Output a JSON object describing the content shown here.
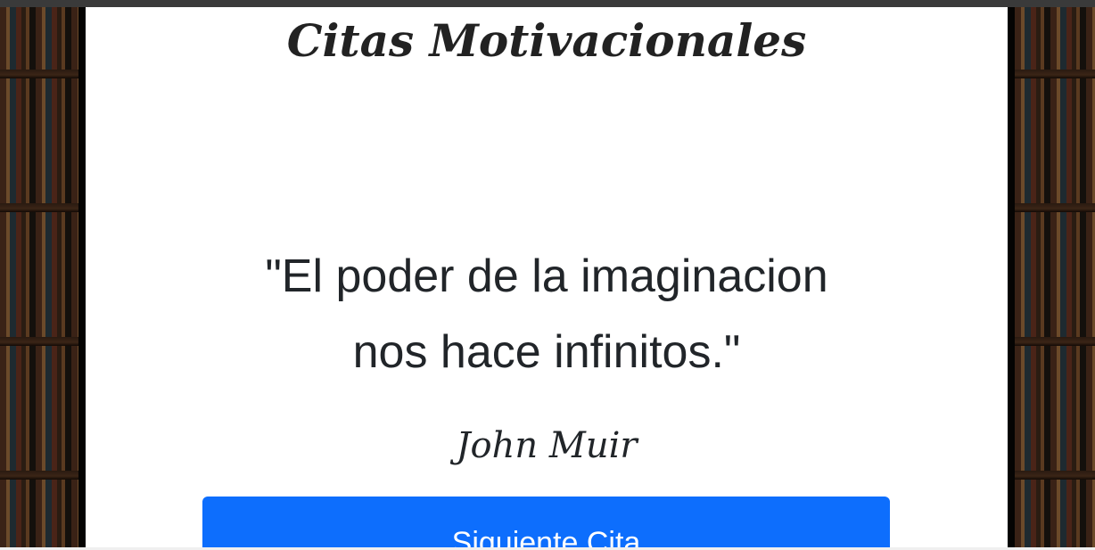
{
  "app": {
    "title": "Citas Motivacionales"
  },
  "quote": {
    "text": "\"El poder de la imaginacion nos hace infinitos.\"",
    "author": "John Muir"
  },
  "actions": {
    "next_label": "Siguiente Cita"
  },
  "colors": {
    "button": "#0d6efd",
    "card": "#ffffff",
    "text": "#212529"
  }
}
